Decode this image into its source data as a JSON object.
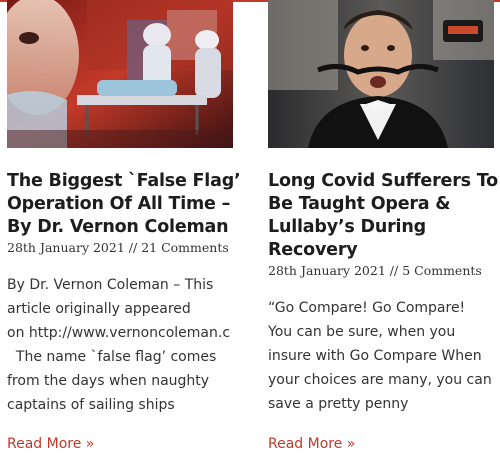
{
  "posts": [
    {
      "image": "medical-workers-gurney-photo",
      "title": "The Biggest `False Flag’ Operation Of All Time – By Dr. Vernon Coleman",
      "date": "28th January 2021",
      "separator": "//",
      "comments": "21 Comments",
      "excerpt_lines": [
        "By Dr. Vernon Coleman – This",
        "article originally appeared",
        "on http://www.vernoncoleman.c",
        "  The name `false flag’ comes",
        "from the days when naughty",
        "captains of sailing ships"
      ],
      "read_more": "Read More »"
    },
    {
      "image": "opera-singer-in-car-photo",
      "title": "Long Covid Sufferers To Be Taught Opera & Lullaby’s During Recovery",
      "date": "28th January 2021",
      "separator": "//",
      "comments": "5 Comments",
      "excerpt_lines": [
        "“Go Compare! Go Compare!",
        "You can be sure, when you",
        "insure with Go Compare When",
        "your choices are many, you can",
        "save a pretty penny"
      ],
      "read_more": "Read More »"
    }
  ],
  "colors": {
    "accent": "#c0392b",
    "title": "#1d1d1d",
    "text": "#333333"
  }
}
